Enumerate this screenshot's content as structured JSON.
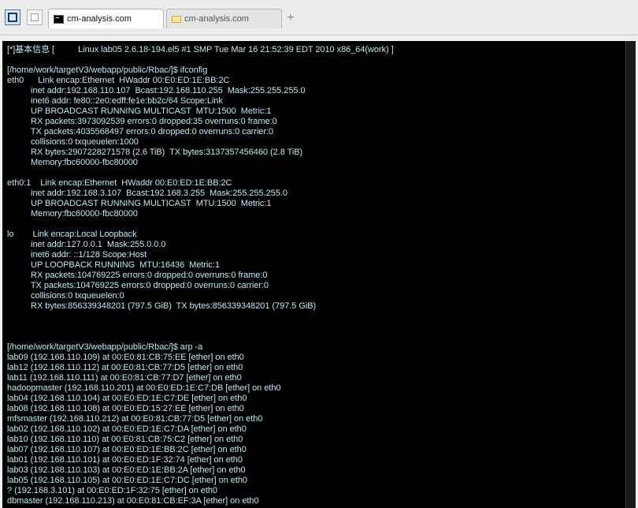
{
  "tabs": [
    {
      "label": "cm-analysis.com",
      "icon": "terminal-icon",
      "active": true
    },
    {
      "label": "cm-analysis.com",
      "icon": "folder-icon",
      "active": false
    }
  ],
  "add_tab_glyph": "+",
  "terminal": {
    "text_color": "#bfe9f2",
    "background": "#000000",
    "lines": [
      "[*]基本信息 [          Linux lab05 2.6.18-194.el5 #1 SMP Tue Mar 16 21:52:39 EDT 2010 x86_64(work) ]",
      "",
      "[/home/work/targetV3/webapp/public/Rbac/]$ ifconfig",
      "eth0      Link encap:Ethernet  HWaddr 00:E0:ED:1E:BB:2C",
      "          inet addr:192.168.110.107  Bcast:192.168.110.255  Mask:255.255.255.0",
      "          inet6 addr: fe80::2e0:edff:fe1e:bb2c/64 Scope:Link",
      "          UP BROADCAST RUNNING MULTICAST  MTU:1500  Metric:1",
      "          RX packets:3973092539 errors:0 dropped:35 overruns:0 frame:0",
      "          TX packets:4035568497 errors:0 dropped:0 overruns:0 carrier:0",
      "          collisions:0 txqueuelen:1000",
      "          RX bytes:2907228271578 (2.6 TiB)  TX bytes:3137357456460 (2.8 TiB)",
      "          Memory:fbc60000-fbc80000",
      "",
      "eth0:1    Link encap:Ethernet  HWaddr 00:E0:ED:1E:BB:2C",
      "          inet addr:192.168.3.107  Bcast:192.168.3.255  Mask:255.255.255.0",
      "          UP BROADCAST RUNNING MULTICAST  MTU:1500  Metric:1",
      "          Memory:fbc60000-fbc80000",
      "",
      "lo        Link encap:Local Loopback",
      "          inet addr:127.0.0.1  Mask:255.0.0.0",
      "          inet6 addr: ::1/128 Scope:Host",
      "          UP LOOPBACK RUNNING  MTU:16436  Metric:1",
      "          RX packets:104769225 errors:0 dropped:0 overruns:0 frame:0",
      "          TX packets:104769225 errors:0 dropped:0 overruns:0 carrier:0",
      "          collisions:0 txqueuelen:0",
      "          RX bytes:856339348201 (797.5 GiB)  TX bytes:856339348201 (797.5 GiB)",
      "",
      "",
      "",
      "[/home/work/targetV3/webapp/public/Rbac/]$ arp -a",
      "lab09 (192.168.110.109) at 00:E0:81:CB:75:EE [ether] on eth0",
      "lab12 (192.168.110.112) at 00:E0:81:CB:77:D5 [ether] on eth0",
      "lab11 (192.168.110.111) at 00:E0:81:CB:77:D7 [ether] on eth0",
      "hadoopmaster (192.168.110.201) at 00:E0:ED:1E:C7:DB [ether] on eth0",
      "lab04 (192.168.110.104) at 00:E0:ED:1E:C7:DE [ether] on eth0",
      "lab08 (192.168.110.108) at 00:E0:ED:15:27:EE [ether] on eth0",
      "mfsmaster (192.168.110.212) at 00:E0:81:CB:77:D5 [ether] on eth0",
      "lab02 (192.168.110.102) at 00:E0:ED:1E:C7:DA [ether] on eth0",
      "lab10 (192.168.110.110) at 00:E0:81:CB:75:C2 [ether] on eth0",
      "lab07 (192.168.110.107) at 00:E0:ED:1E:BB:2C [ether] on eth0",
      "lab01 (192.168.110.101) at 00:E0:ED:1F:32:74 [ether] on eth0",
      "lab03 (192.168.110.103) at 00:E0:ED:1E:BB:2A [ether] on eth0",
      "lab05 (192.168.110.105) at 00:E0:ED:1E:C7:DC [ether] on eth0",
      "? (192.168.3.101) at 00:E0:ED:1F:32:75 [ether] on eth0",
      "dbmaster (192.168.110.213) at 00:E0:81:CB:EF:3A [ether] on eth0"
    ]
  }
}
